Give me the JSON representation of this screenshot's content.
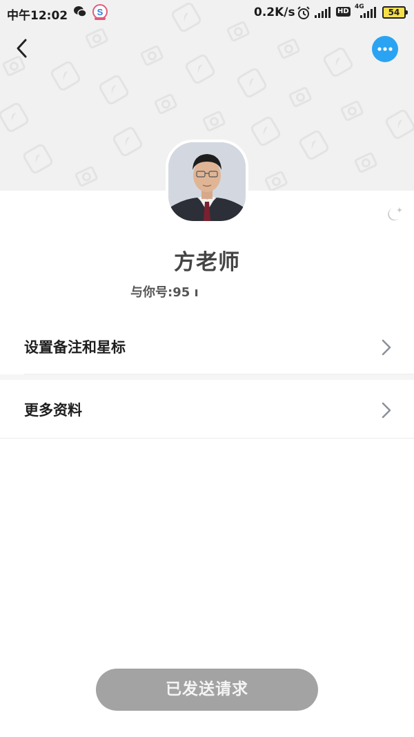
{
  "status_bar": {
    "time": "中午12:02",
    "net_speed": "0.2K/s",
    "hd_label": "HD",
    "network_label": "4G",
    "battery": "54",
    "icons": [
      "wechat-icon",
      "app-icon",
      "alarm-icon",
      "signal-icon",
      "signal-icon",
      "battery-icon"
    ]
  },
  "nav": {
    "back_icon": "chevron-left-icon",
    "more_icon": "more-dots-icon",
    "accent_color": "#2aa3f3"
  },
  "profile": {
    "name": "方老师",
    "relation_text": "与你号:95 ı",
    "night_icon": "moon-star-icon"
  },
  "rows": [
    {
      "label": "设置备注和星标",
      "icon": "chevron-right-icon"
    },
    {
      "label": "更多资料",
      "icon": "chevron-right-icon"
    }
  ],
  "footer": {
    "request_button_label": "已发送请求"
  }
}
